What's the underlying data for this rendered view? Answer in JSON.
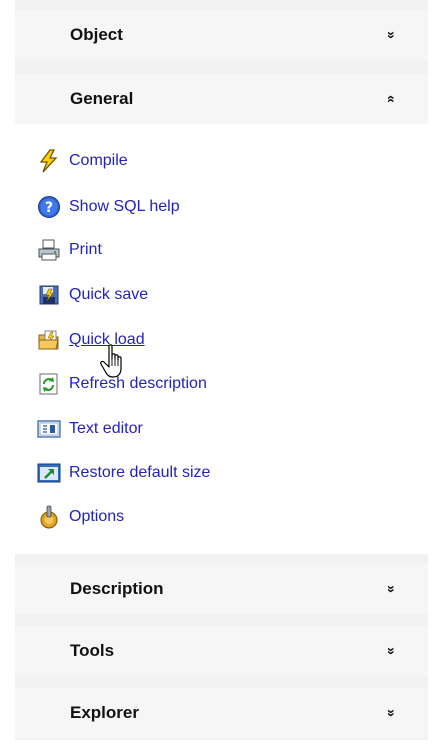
{
  "groups": {
    "object": {
      "title": "Object",
      "chevron": "»"
    },
    "general": {
      "title": "General",
      "chevron": "«",
      "items": [
        {
          "label": "Compile",
          "icon": "lightning-icon"
        },
        {
          "label": "Show SQL help",
          "icon": "help-icon"
        },
        {
          "label": "Print",
          "icon": "printer-icon"
        },
        {
          "label": "Quick save",
          "icon": "quick-save-icon"
        },
        {
          "label": "Quick load",
          "icon": "quick-load-icon"
        },
        {
          "label": "Refresh description",
          "icon": "refresh-icon"
        },
        {
          "label": "Text editor",
          "icon": "text-editor-icon"
        },
        {
          "label": "Restore default size",
          "icon": "restore-size-icon"
        },
        {
          "label": "Options",
          "icon": "options-icon"
        }
      ]
    },
    "description": {
      "title": "Description",
      "chevron": "»"
    },
    "tools": {
      "title": "Tools",
      "chevron": "»"
    },
    "explorer": {
      "title": "Explorer",
      "chevron": "»"
    }
  },
  "colors": {
    "link": "#2323b8",
    "header_bg": "#f6f6f6",
    "panel_bg": "#f2f2f2"
  }
}
